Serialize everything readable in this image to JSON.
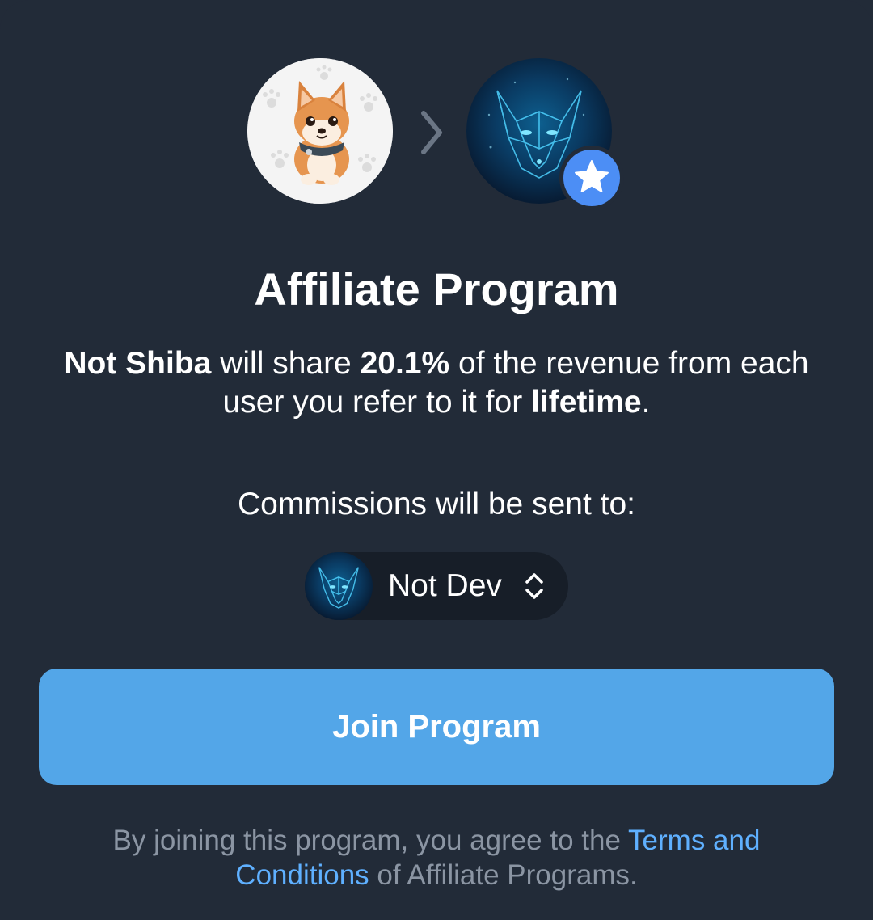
{
  "header": {
    "bot_avatar_icon": "shiba-dog-avatar",
    "arrow_icon": "chevron-right-icon",
    "target_avatar_icon": "neon-wolf-avatar",
    "badge_icon": "star-icon"
  },
  "title": "Affiliate Program",
  "description": {
    "bot_name": "Not Shiba",
    "part1": " will share ",
    "percent": "20.1%",
    "part2": " of the revenue from each user you refer to it for ",
    "duration": "lifetime",
    "part3": "."
  },
  "commissions_label": "Commissions will be sent to:",
  "recipient": {
    "name": "Not Dev",
    "selector_icon": "chevron-up-down-icon"
  },
  "join_button_label": "Join Program",
  "terms": {
    "prefix": "By joining this program, you agree to the ",
    "link_text": "Terms and Conditions",
    "suffix": " of Affiliate Programs."
  },
  "colors": {
    "background": "#222b38",
    "button": "#53a6e8",
    "link": "#5fb0ff",
    "badge": "#4c8ef5",
    "muted_text": "#8b95a3"
  }
}
